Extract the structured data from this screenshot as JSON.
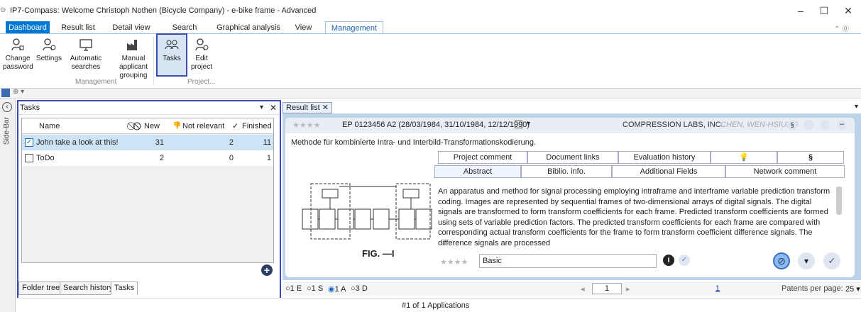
{
  "window": {
    "title": "IP7-Compass: Welcome Christoph Nothen (Bicycle Company) - e-bike frame - Advanced",
    "minimize": "–",
    "maximize": "☐",
    "close": "✕",
    "ribbon_controls": "⌃ ⓪"
  },
  "tabs": [
    "Dashboard",
    "Result list",
    "Detail view",
    "Search",
    "Graphical analysis",
    "View",
    "Management"
  ],
  "ribbon": {
    "buttons": [
      {
        "line1": "Change",
        "line2": "password"
      },
      {
        "line1": "Settings",
        "line2": ""
      },
      {
        "line1": "Automatic",
        "line2": "searches"
      },
      {
        "line1": "Manual applicant",
        "line2": "grouping"
      },
      {
        "line1": "Tasks",
        "line2": ""
      },
      {
        "line1": "Edit",
        "line2": "project"
      }
    ],
    "group_management": "Management",
    "group_project": "Project..."
  },
  "sidebar_label": "Side-Bar",
  "tasks_panel": {
    "title": "Tasks",
    "pin": "▾",
    "close": "✕",
    "columns": {
      "name": "Name",
      "new": "New",
      "not_relevant": "Not relevant",
      "finished": "Finished"
    },
    "rows": [
      {
        "name": "John take a look at this!",
        "new": "31",
        "not_relevant": "2",
        "finished": "11",
        "checked": true
      },
      {
        "name": "ToDo",
        "new": "2",
        "not_relevant": "0",
        "finished": "1",
        "checked": false
      }
    ],
    "add": "+",
    "bottom_tabs": [
      "Folder tree",
      "Search history",
      "Tasks"
    ]
  },
  "result_list": {
    "tab_label": "Result list",
    "tab_close": "✕",
    "patent_ref": "EP 0123456 A2 (28/03/1984, 31/10/1984, 12/12/1990)",
    "applicant": "COMPRESSION LABS, INC.",
    "inventor": "CHEN, WEN-HSIUNG",
    "title_text": "Methode für kombinierte Intra- und Interbild-Transformationskodierung.",
    "subtabs_row1": [
      "Project comment",
      "Document links",
      "Evaluation history",
      "",
      "§"
    ],
    "subtabs_row2": [
      "Abstract",
      "Biblio. info.",
      "Additional Fields",
      "Network comment"
    ],
    "abstract": "An apparatus and method for signal processing employing intraframe and interframe variable prediction transform coding. Images are represented by sequential frames of two-dimensional arrays of digital signals. The digital signals are transformed to form transform coefficients for each frame. Predicted transform coefficients are formed using sets of variable prediction factors. The predicted transform coefficients for each frame are compared with corresponding actual transform coefficients for the frame to form transform coefficient difference signals. The difference signals are processed",
    "figure_caption": "FIG. —I",
    "rating_label": "Basic",
    "stars": "★★★★",
    "radio_options": [
      "1 E",
      "1 S",
      "1 A",
      "3 D"
    ],
    "page_value": "1",
    "page_total": "1",
    "patents_per_page_label": "Patents per page:",
    "patents_per_page": "25",
    "status": "#1 of 1 Applications"
  }
}
